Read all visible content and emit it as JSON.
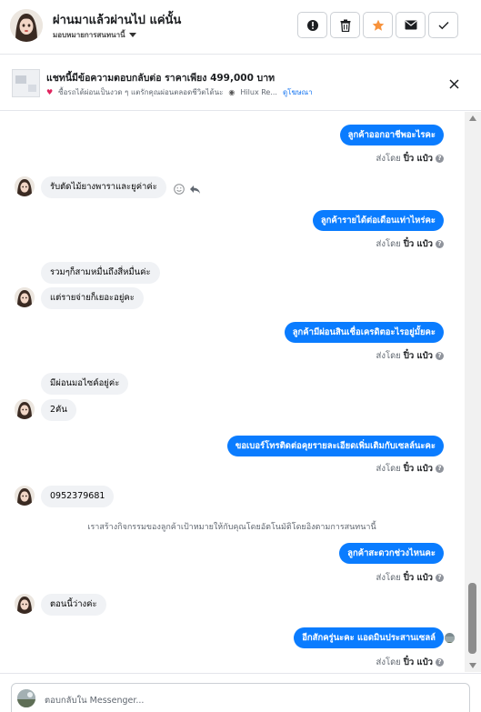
{
  "header": {
    "title": "ผ่านมาแล้วผ่านไป แค่นั้น",
    "assign_label": "มอบหมายการสนทนานี้",
    "buttons": {
      "alert": "alert-icon",
      "trash": "trash-icon",
      "star": "star-icon",
      "mail": "envelope-icon",
      "done": "check-icon"
    },
    "star_color": "#f7923b"
  },
  "ad": {
    "title": "แชทนี้มีข้อความตอบกลับต่อ ราคาเพียง 499,000 บาท",
    "subtitle": "ซื้อรถได้ผ่อนเป็นงวด ๆ แตรักคุณผ่อนตลอดชีวิตได้นะ",
    "subtitle_extra": "Hilux Re...",
    "link": "ดูโฆษณา"
  },
  "messages": [
    {
      "dir": "out",
      "text": "ลูกค้าออกอาชีพอะไรคะ",
      "sent_label": "ส่งโดย",
      "sender": "ปิ๋ว แป๋ว"
    },
    {
      "dir": "in",
      "text": "รับตัดไม้ยางพาราและยูค่าค่ะ"
    },
    {
      "dir": "out",
      "text": "ลูกค้ารายได้ต่อเดือนเท่าไหร่คะ",
      "sent_label": "ส่งโดย",
      "sender": "ปิ๋ว แป๋ว"
    },
    {
      "dir": "in",
      "text": "รวมๆก็สามหมื่นถึงสี่หมื่นค่ะ"
    },
    {
      "dir": "in",
      "text": "แต่รายจ่ายก็เยอะอยู่คะ"
    },
    {
      "dir": "out",
      "text": "ลูกค้ามีผ่อนสินเชื่อเครดิตอะไรอยู่มั้ยคะ",
      "sent_label": "ส่งโดย",
      "sender": "ปิ๋ว แป๋ว"
    },
    {
      "dir": "in",
      "text": "มีผ่อนมอไซค์อยู่ค่ะ"
    },
    {
      "dir": "in",
      "text": "2คัน"
    },
    {
      "dir": "out",
      "text": "ขอเบอร์โทรติดต่อคุยรายละเอียดเพิ่มเติมกับเซลล์นะคะ",
      "sent_label": "ส่งโดย",
      "sender": "ปิ๋ว แป๋ว"
    },
    {
      "dir": "in",
      "text": "0952379681"
    },
    {
      "dir": "system",
      "text": "เราสร้างกิจกรรมของลูกค้าเป้าหมายให้กับคุณโดยอัตโนมัติโดยอิงตามการสนทนานี้"
    },
    {
      "dir": "out",
      "text": "ลูกค้าสะดวกช่วงไหนคะ",
      "sent_label": "ส่งโดย",
      "sender": "ปิ๋ว แป๋ว"
    },
    {
      "dir": "in",
      "text": "ตอนนี้ว่างค่ะ"
    },
    {
      "dir": "out",
      "text": "อีกสักครู่นะคะ แอดมินประสานเซลล์",
      "sent_label": "ส่งโดย",
      "sender": "ปิ๋ว แป๋ว"
    }
  ],
  "composer": {
    "placeholder": "ตอบกลับใน Messenger..."
  },
  "colors": {
    "accent": "#0a7cff",
    "incoming_bubble": "#f0f2f5",
    "link": "#1877f2"
  }
}
